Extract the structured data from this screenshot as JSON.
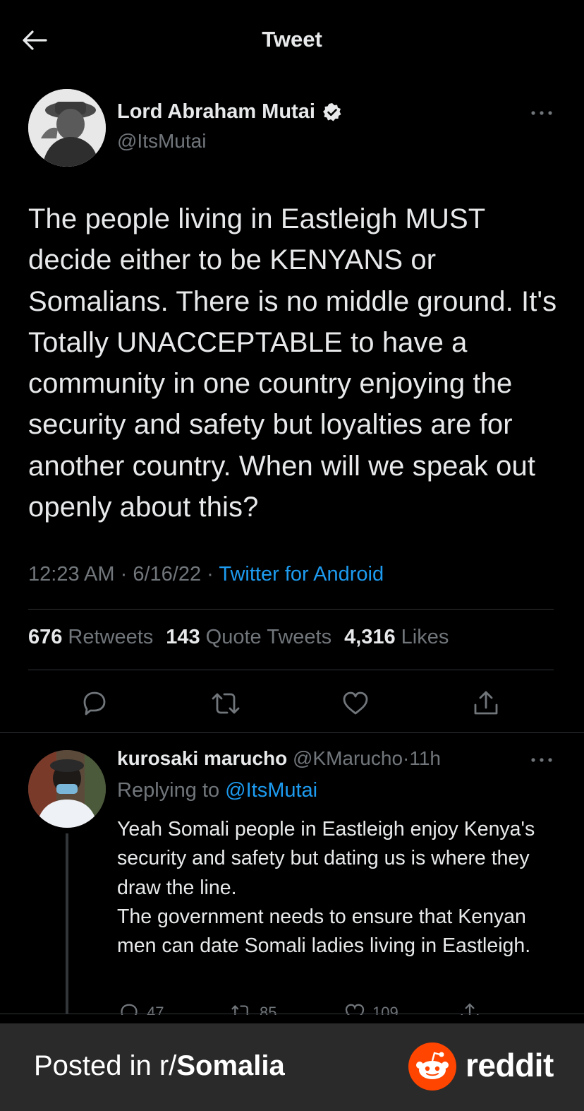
{
  "header": {
    "back_icon": "arrow-left-icon",
    "title": "Tweet"
  },
  "tweet": {
    "author_name": "Lord Abraham Mutai",
    "author_handle": "@ItsMutai",
    "text": "The people living in Eastleigh MUST decide either to be KENYANS or Somalians. There is no middle ground. It's Totally UNACCEPTABLE to have a community in one country enjoying the security and safety but loyalties are for another country. When will we speak out openly about this?",
    "time": "12:23 AM",
    "date": "6/16/22",
    "separator": "·",
    "source": "Twitter for Android",
    "stats": {
      "retweets_count": "676",
      "retweets_label": "Retweets",
      "quotes_count": "143",
      "quotes_label": "Quote Tweets",
      "likes_count": "4,316",
      "likes_label": "Likes"
    }
  },
  "reply": {
    "author_name": "kurosaki marucho",
    "author_handle": "@KMarucho",
    "age": "11h",
    "replying_to_label": "Replying to",
    "replying_to_handle": "@ItsMutai",
    "text": "Yeah Somali people in Eastleigh enjoy Kenya's security and safety but dating us is where they draw the line.\nThe government needs to ensure that Kenyan men can date Somali ladies living in Eastleigh.",
    "counts": {
      "replies": "47",
      "retweets": "85",
      "likes": "109"
    }
  },
  "footer": {
    "posted_in": "Posted in r/",
    "subreddit": "Somalia",
    "brand": "reddit"
  },
  "colors": {
    "background": "#000000",
    "text": "#e7e9ea",
    "muted": "#71767b",
    "link": "#1d9bf0",
    "divider": "#2f3336",
    "footer_bg": "#2a2a2a",
    "reddit_orange": "#ff4500"
  }
}
